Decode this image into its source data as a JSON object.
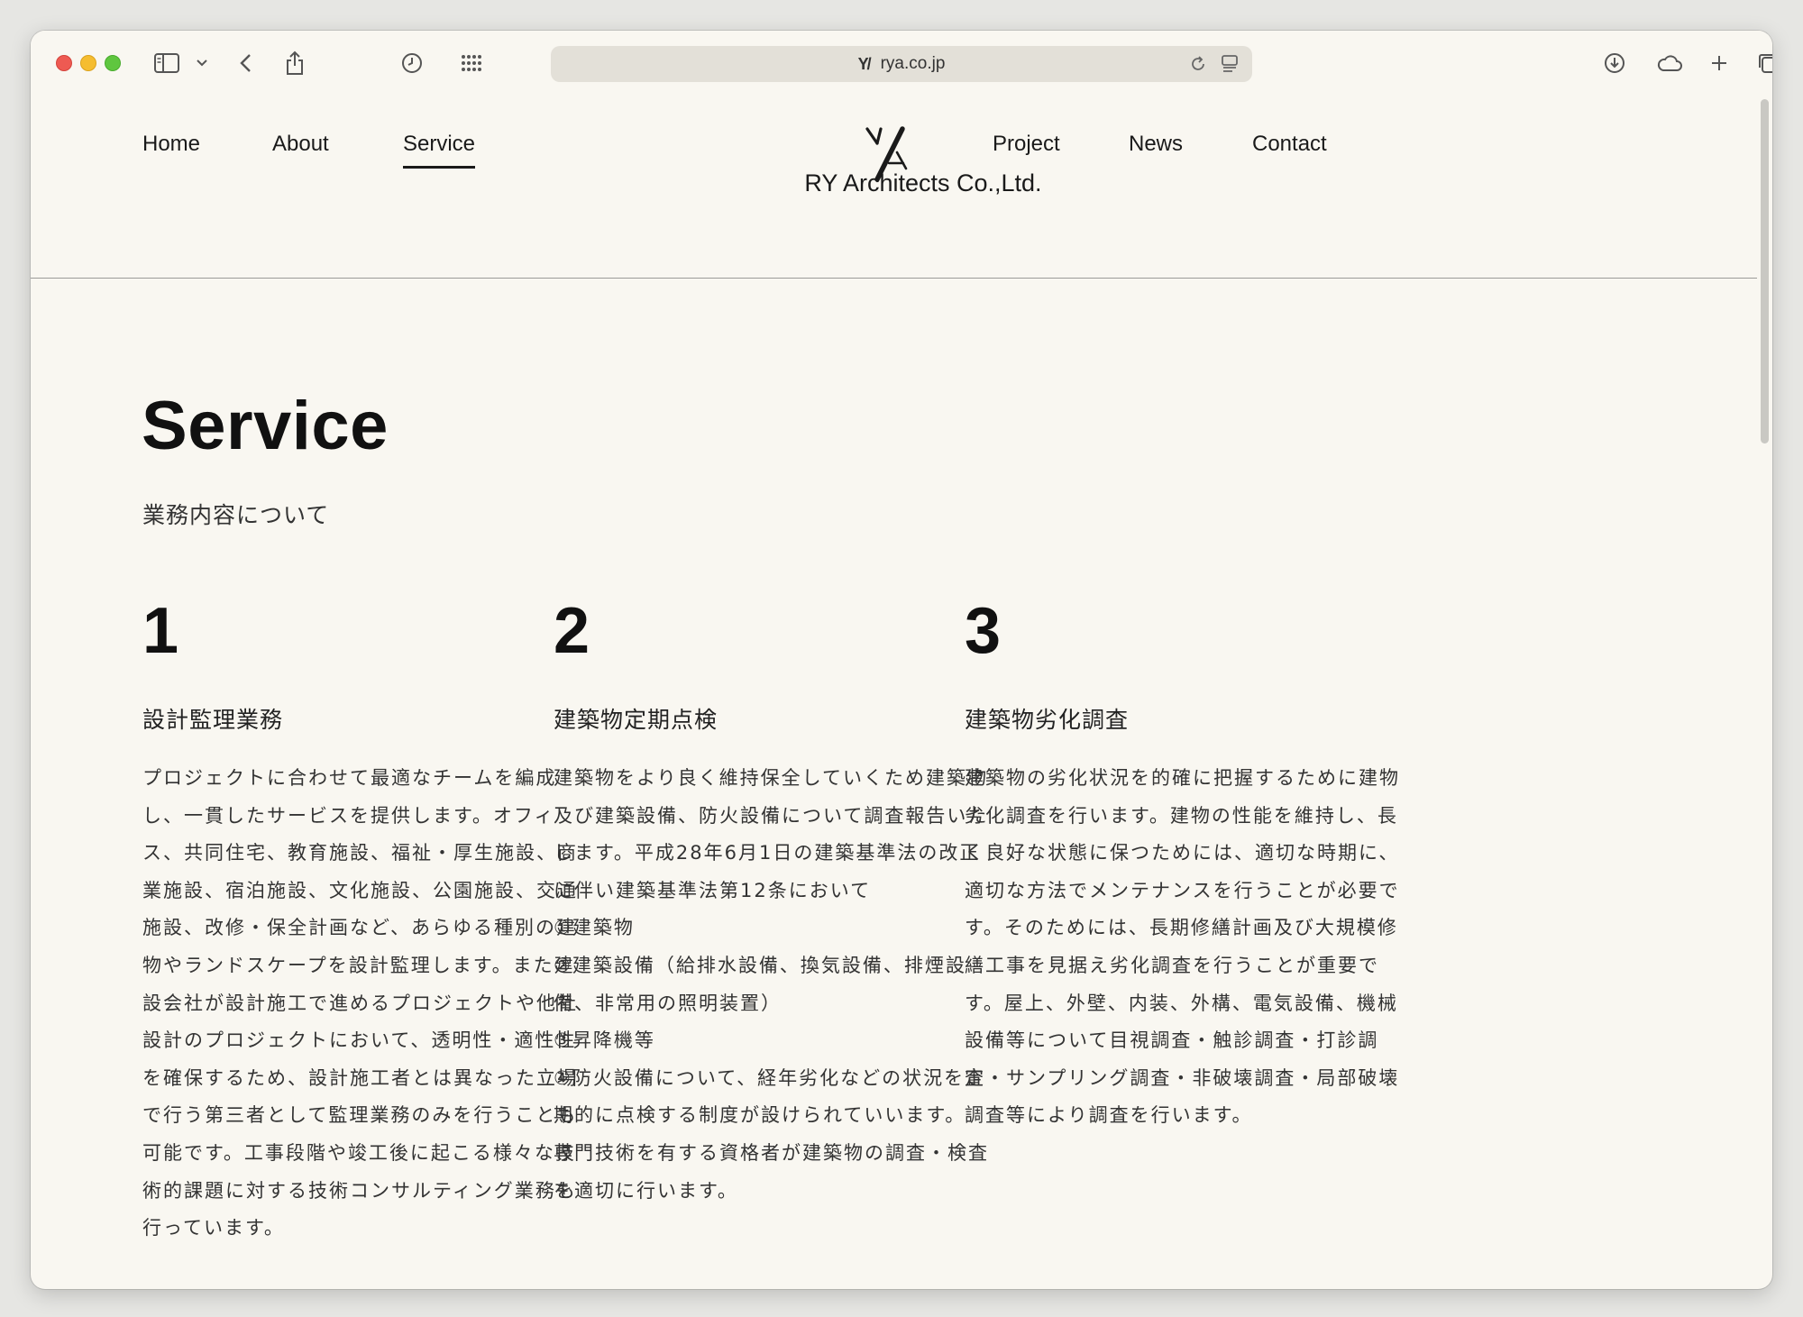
{
  "browser": {
    "url": "rya.co.jp",
    "favicon_text": "Y/"
  },
  "nav": {
    "items": [
      {
        "label": "Home"
      },
      {
        "label": "About"
      },
      {
        "label": "Service",
        "active": true
      },
      {
        "label": "Project"
      },
      {
        "label": "News"
      },
      {
        "label": "Contact"
      }
    ]
  },
  "brand": {
    "name": "RY Architects Co.,Ltd."
  },
  "main": {
    "title": "Service",
    "subtitle": "業務内容について",
    "services": [
      {
        "number": "1",
        "heading": "設計監理業務",
        "body": "プロジェクトに合わせて最適なチームを編成\nし、一貫したサービスを提供します。オフィ\nス、共同住宅、教育施設、福祉・厚生施設、商\n業施設、宿泊施設、文化施設、公園施設、交通\n施設、改修・保全計画など、あらゆる種別の建\n物やランドスケープを設計監理します。また建\n設会社が設計施工で進めるプロジェクトや他社\n設計のプロジェクトにおいて、透明性・適性性\nを確保するため、設計施工者とは異なった立場\nで行う第三者として監理業務のみを行うことも\n可能です。工事段階や竣工後に起こる様々な技\n術的課題に対する技術コンサルティング業務も\n行っています。"
      },
      {
        "number": "2",
        "heading": "建築物定期点検",
        "body": "建築物をより良く維持保全していくため建築物\n及び建築設備、防火設備について調査報告いた\nします。平成28年6月1日の建築基準法の改正\nに伴い建築基準法第12条において\n①建築物\n②建築設備（給排水設備、換気設備、排煙設\n備、非常用の照明装置）\n③昇降機等\n④防火設備について、経年劣化などの状況を定\n期的に点検する制度が設けられていいます。\n専門技術を有する資格者が建築物の調査・検査\nを適切に行います。"
      },
      {
        "number": "3",
        "heading": "建築物劣化調査",
        "body": "建築物の劣化状況を的確に把握するために建物\n劣化調査を行います。建物の性能を維持し、長\nく良好な状態に保つためには、適切な時期に、\n適切な方法でメンテナンスを行うことが必要で\nす。そのためには、長期修繕計画及び大規模修\n繕工事を見据え劣化調査を行うことが重要で\nす。屋上、外壁、内装、外構、電気設備、機械\n設備等について目視調査・触診調査・打診調\n査・サンプリング調査・非破壊調査・局部破壊\n調査等により調査を行います。"
      }
    ]
  },
  "colors": {
    "page_bg": "#f9f7f1",
    "text": "#1a1a1a",
    "address_bar": "#e3e0d8"
  }
}
